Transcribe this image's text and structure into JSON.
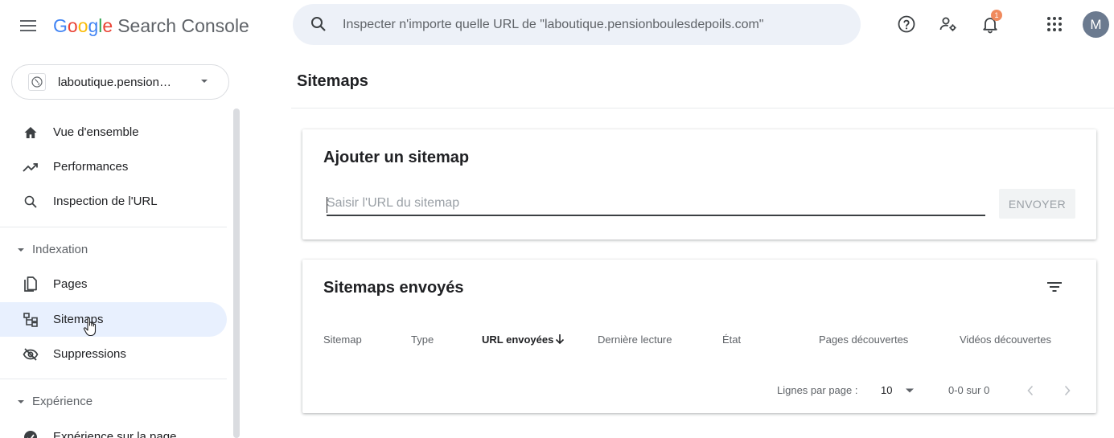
{
  "topbar": {
    "logo_letters": [
      "G",
      "o",
      "o",
      "g",
      "l",
      "e"
    ],
    "product_name": "Search Console",
    "search_placeholder": "Inspecter n'importe quelle URL de \"laboutique.pensionboulesdepoils.com\"",
    "notification_count": "1",
    "avatar_initial": "M"
  },
  "sidebar": {
    "property_name": "laboutique.pension…",
    "items_top": [
      {
        "label": "Vue d'ensemble",
        "icon": "home-icon"
      },
      {
        "label": "Performances",
        "icon": "trending-up-icon"
      },
      {
        "label": "Inspection de l'URL",
        "icon": "search-icon"
      }
    ],
    "section_indexation": "Indexation",
    "items_indexation": [
      {
        "label": "Pages",
        "icon": "pages-icon"
      },
      {
        "label": "Sitemaps",
        "icon": "sitemap-icon",
        "active": true
      },
      {
        "label": "Suppressions",
        "icon": "visibility-off-icon"
      }
    ],
    "section_experience": "Expérience",
    "items_experience": [
      {
        "label": "Expérience sur la page",
        "icon": "page-experience-icon"
      }
    ]
  },
  "main": {
    "page_title": "Sitemaps",
    "add_card": {
      "title": "Ajouter un sitemap",
      "input_placeholder": "Saisir l'URL du sitemap",
      "input_value": "",
      "submit_label": "ENVOYER"
    },
    "sent_card": {
      "title": "Sitemaps envoyés",
      "columns": [
        "Sitemap",
        "Type",
        "URL envoyées",
        "Dernière lecture",
        "État",
        "Pages découvertes",
        "Vidéos découvertes"
      ],
      "sorted_column": "URL envoyées",
      "rows": [],
      "rows_per_page_label": "Lignes par page :",
      "rows_per_page": "10",
      "range_label": "0-0 sur 0"
    }
  },
  "colors": {
    "accent": "#1a73e8",
    "active_nav_bg": "#e8f0fe",
    "search_bg": "#edf1f8",
    "badge": "#f08a5d",
    "avatar": "#6b7a8f"
  }
}
